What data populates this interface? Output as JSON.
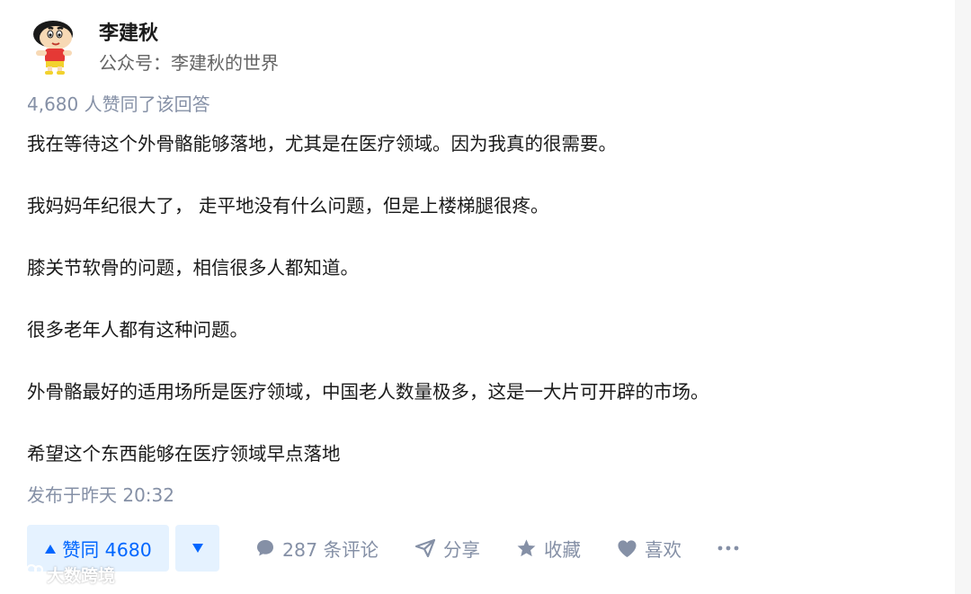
{
  "author": {
    "name": "李建秋",
    "subtitle": "公众号：李建秋的世界",
    "avatar_icon": "cartoon-boy-avatar"
  },
  "agree_summary": "4,680 人赞同了该回答",
  "content": {
    "paragraphs": [
      "我在等待这个外骨骼能够落地，尤其是在医疗领域。因为我真的很需要。",
      "我妈妈年纪很大了， 走平地没有什么问题，但是上楼梯腿很疼。",
      "膝关节软骨的问题，相信很多人都知道。",
      "很多老年人都有这种问题。",
      "外骨骼最好的适用场所是医疗领域，中国老人数量极多，这是一大片可开辟的市场。",
      "希望这个东西能够在医疗领域早点落地"
    ]
  },
  "publish_time": "发布于昨天 20:32",
  "actions": {
    "upvote_label": "赞同 4680",
    "comments_label": "287 条评论",
    "share_label": "分享",
    "collect_label": "收藏",
    "like_label": "喜欢"
  },
  "watermark": "大数跨境",
  "colors": {
    "accent": "#0066ff",
    "accent_bg": "#e5f2ff",
    "meta_gray": "#8590a6"
  }
}
